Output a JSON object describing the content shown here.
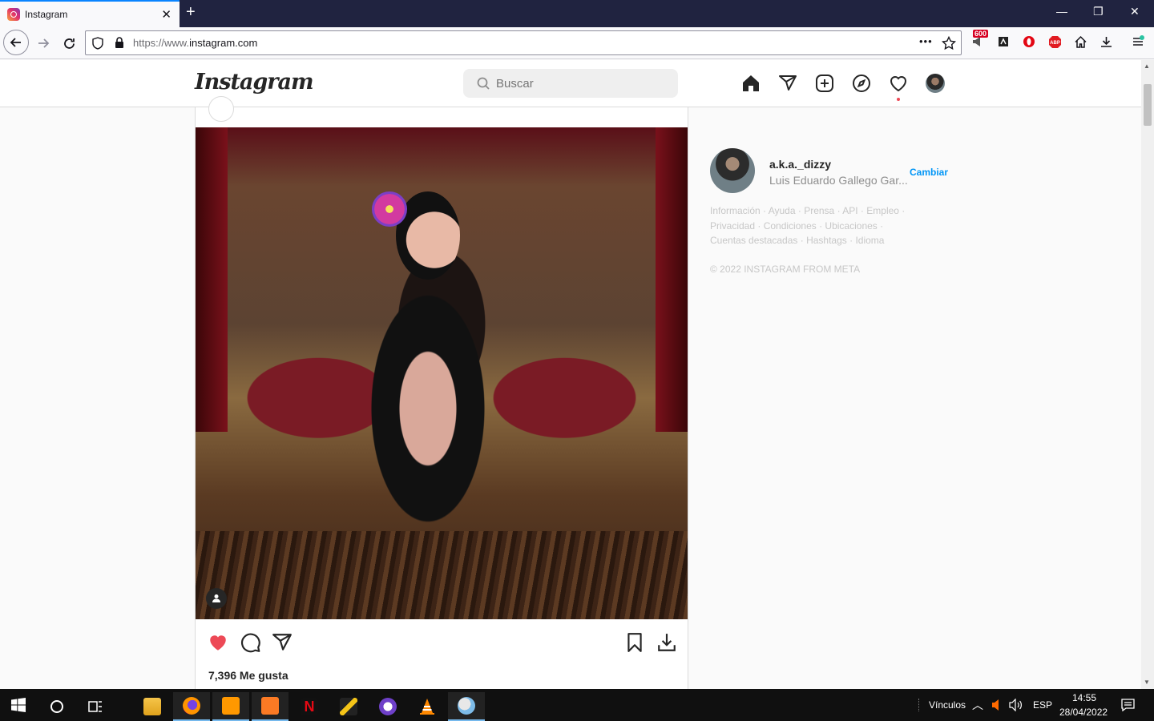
{
  "browser": {
    "tab_title": "Instagram",
    "tab_close": "✕",
    "new_tab": "+",
    "url_prefix": "https://www.",
    "url_domain": "instagram.com",
    "page_actions": "•••",
    "ext_badge": "600",
    "window_controls": {
      "minimize": "—",
      "restore": "❐",
      "close": "✕"
    }
  },
  "instagram": {
    "logo": "Instagram",
    "search_placeholder": "Buscar",
    "post": {
      "likes": "7,396 Me gusta"
    },
    "sidebar": {
      "username": "a.k.a._dizzy",
      "full_name": "Luis Eduardo Gallego Gar...",
      "switch_label": "Cambiar",
      "footer_links": [
        "Información",
        "Ayuda",
        "Prensa",
        "API",
        "Empleo",
        "Privacidad",
        "Condiciones",
        "Ubicaciones",
        "Cuentas destacadas",
        "Hashtags",
        "Idioma"
      ],
      "copyright": "© 2022 INSTAGRAM FROM META"
    }
  },
  "taskbar": {
    "links_label": "Vínculos",
    "language": "ESP",
    "time": "14:55",
    "date": "28/04/2022"
  },
  "colors": {
    "like_red": "#ed4956",
    "link_blue": "#0095f6",
    "firefox_tabbar": "#202340"
  }
}
